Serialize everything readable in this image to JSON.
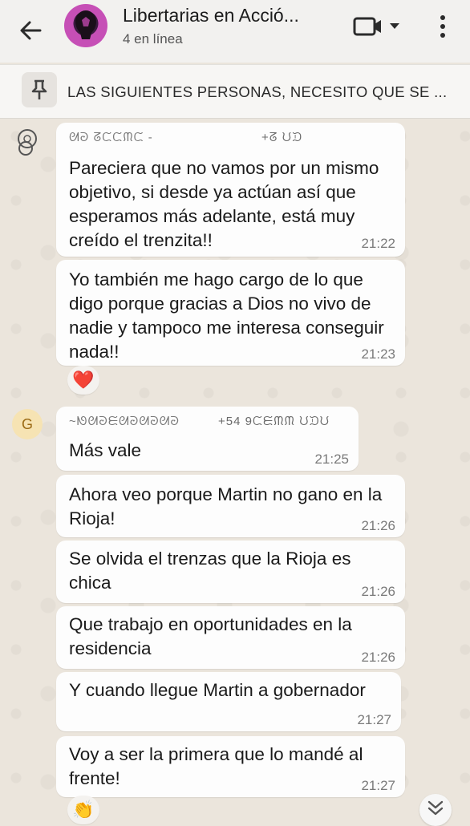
{
  "header": {
    "title": "Libertarias en Acció...",
    "subtitle": "4 en línea"
  },
  "pinned": {
    "text": "LAS SIGUIENTES PERSONAS, NECESITO QUE SE ..."
  },
  "messages": [
    {
      "sender": "ᘛᘒ ᘔᙅᙅᙏᙅ -",
      "sender_phone": "+ᘔ ᙀᙃ",
      "text": "Pareciera que no vamos por un mismo objetivo, si desde ya actúan así que esperamos más adelante, está muy creído el trenzita!!",
      "time": "21:22"
    },
    {
      "text": "Yo también me hago cargo de lo que digo porque gracias a Dios no vivo de nadie y tampoco me interesa conseguir nada!!",
      "time": "21:23",
      "reaction": "❤️"
    },
    {
      "sender": "~ᘚᘛᘒᙓᘛᘒᘛᘒᘛᘒ",
      "sender_phone": "+54 9ᙅᙓᙏᙏ ᙀᙃᙀ",
      "text": "Más vale",
      "time": "21:25",
      "avatar_letter": "G"
    },
    {
      "text": "Ahora veo porque Martin no gano en la Rioja!",
      "time": "21:26"
    },
    {
      "text": "Se olvida el trenzas que la Rioja es chica",
      "time": "21:26"
    },
    {
      "text": "Que trabajo en oportunidades en la residencia",
      "time": "21:26"
    },
    {
      "text": "Y cuando llegue Martin a gobernador",
      "time": "21:27"
    },
    {
      "text": "Voy a ser la primera que lo mandé al frente!",
      "time": "21:27",
      "reaction": "👏"
    }
  ]
}
